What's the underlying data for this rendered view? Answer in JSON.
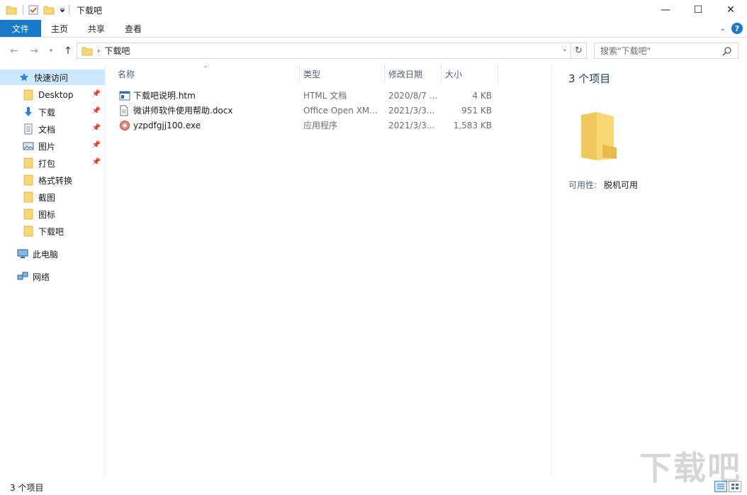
{
  "window": {
    "title": "下载吧",
    "controls": {
      "minimize": "—",
      "maximize": "☐",
      "close": "✕"
    }
  },
  "ribbon": {
    "tabs": [
      {
        "label": "文件"
      },
      {
        "label": "主页"
      },
      {
        "label": "共享"
      },
      {
        "label": "查看"
      }
    ],
    "help": "?"
  },
  "address": {
    "path": [
      "下载吧"
    ],
    "search_placeholder": "搜索\"下载吧\""
  },
  "nav": {
    "quick_access": "快速访问",
    "items": [
      {
        "label": "Desktop",
        "icon": "folder-icon",
        "pinned": true
      },
      {
        "label": "下载",
        "icon": "download-arrow-icon",
        "pinned": true
      },
      {
        "label": "文档",
        "icon": "document-icon",
        "pinned": true
      },
      {
        "label": "图片",
        "icon": "picture-icon",
        "pinned": true
      },
      {
        "label": "打包",
        "icon": "folder-icon",
        "pinned": true
      },
      {
        "label": "格式转换",
        "icon": "folder-icon",
        "pinned": false
      },
      {
        "label": "截图",
        "icon": "folder-icon",
        "pinned": false
      },
      {
        "label": "图标",
        "icon": "folder-icon",
        "pinned": false
      },
      {
        "label": "下载吧",
        "icon": "folder-icon",
        "pinned": false
      }
    ],
    "this_pc": "此电脑",
    "network": "网络"
  },
  "list": {
    "columns": [
      "名称",
      "类型",
      "修改日期",
      "大小"
    ],
    "files": [
      {
        "name": "下载吧说明.htm",
        "type": "HTML 文档",
        "date": "2020/8/7 ...",
        "size": "4 KB",
        "icon": "html-file-icon"
      },
      {
        "name": "微讲师软件使用帮助.docx",
        "type": "Office Open XM...",
        "date": "2021/3/3...",
        "size": "951 KB",
        "icon": "docx-file-icon"
      },
      {
        "name": "yzpdfgjj100.exe",
        "type": "应用程序",
        "date": "2021/3/3...",
        "size": "1,583 KB",
        "icon": "exe-file-icon"
      }
    ]
  },
  "details": {
    "count": "3 个项目",
    "availability_label": "可用性:",
    "availability_value": "脱机可用"
  },
  "status": {
    "count": "3 个项目"
  },
  "watermark": "下载吧",
  "colors": {
    "accent": "#1979ca",
    "selection": "#cce8ff",
    "folder": "#f8d775"
  }
}
